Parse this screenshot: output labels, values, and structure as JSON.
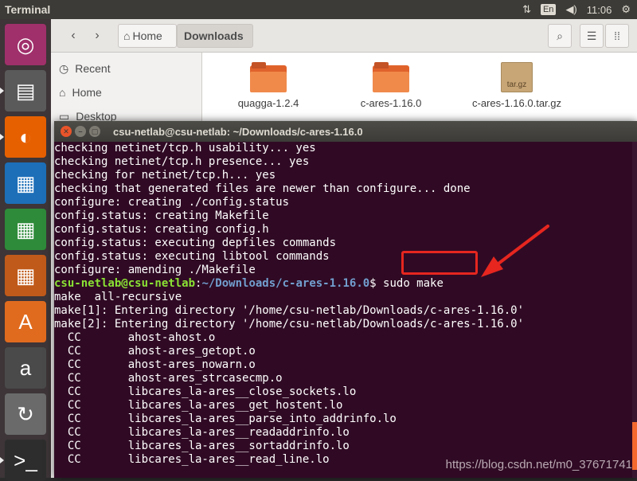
{
  "topbar": {
    "app_title": "Terminal",
    "lang": "En",
    "time": "11:06"
  },
  "launcher": {
    "items": [
      {
        "name": "ubuntu-dash",
        "glyph": "◎",
        "color": "#a0306b"
      },
      {
        "name": "files",
        "glyph": "▤",
        "color": "#5a5a5a"
      },
      {
        "name": "firefox",
        "glyph": "◐",
        "color": "#e66000"
      },
      {
        "name": "writer",
        "glyph": "▦",
        "color": "#1d6fb8"
      },
      {
        "name": "calc",
        "glyph": "▦",
        "color": "#2e8b3a"
      },
      {
        "name": "impress",
        "glyph": "▦",
        "color": "#c05a1a"
      },
      {
        "name": "software-center",
        "glyph": "A",
        "color": "#e06b1f"
      },
      {
        "name": "amazon",
        "glyph": "a",
        "color": "#4a4a4a"
      },
      {
        "name": "updater",
        "glyph": "↻",
        "color": "#6a6a6a"
      },
      {
        "name": "terminal",
        "glyph": ">_",
        "color": "#2d2d2d"
      }
    ]
  },
  "filemanager": {
    "home_label": "Home",
    "current_folder": "Downloads",
    "sidebar": [
      {
        "label": "Recent",
        "icon": "clock-icon"
      },
      {
        "label": "Home",
        "icon": "home-icon"
      },
      {
        "label": "Desktop",
        "icon": "folder-icon"
      }
    ],
    "files": [
      {
        "name": "quagga-1.2.4",
        "kind": "folder"
      },
      {
        "name": "c-ares-1.16.0",
        "kind": "folder"
      },
      {
        "name": "c-ares-1.16.0.tar.gz",
        "kind": "archive",
        "badge": "tar.gz"
      }
    ]
  },
  "terminal": {
    "title": "csu-netlab@csu-netlab: ~/Downloads/c-ares-1.16.0",
    "lines": [
      "checking netinet/tcp.h usability... yes",
      "checking netinet/tcp.h presence... yes",
      "checking for netinet/tcp.h... yes",
      "checking that generated files are newer than configure... done",
      "configure: creating ./config.status",
      "config.status: creating Makefile",
      "config.status: creating config.h",
      "config.status: executing depfiles commands",
      "config.status: executing libtool commands",
      "configure: amending ./Makefile"
    ],
    "prompt": {
      "user": "csu-netlab@csu-netlab",
      "path": "~/Downloads/c-ares-1.16.0",
      "symbol": "$ ",
      "command": "sudo make"
    },
    "output": [
      "make  all-recursive",
      "make[1]: Entering directory '/home/csu-netlab/Downloads/c-ares-1.16.0'",
      "make[2]: Entering directory '/home/csu-netlab/Downloads/c-ares-1.16.0'",
      "  CC       ahost-ahost.o",
      "  CC       ahost-ares_getopt.o",
      "  CC       ahost-ares_nowarn.o",
      "  CC       ahost-ares_strcasecmp.o",
      "  CC       libcares_la-ares__close_sockets.lo",
      "  CC       libcares_la-ares__get_hostent.lo",
      "  CC       libcares_la-ares__parse_into_addrinfo.lo",
      "  CC       libcares_la-ares__readaddrinfo.lo",
      "  CC       libcares_la-ares__sortaddrinfo.lo",
      "  CC       libcares_la-ares__read_line.lo"
    ]
  },
  "watermark": "https://blog.csdn.net/m0_37671741"
}
